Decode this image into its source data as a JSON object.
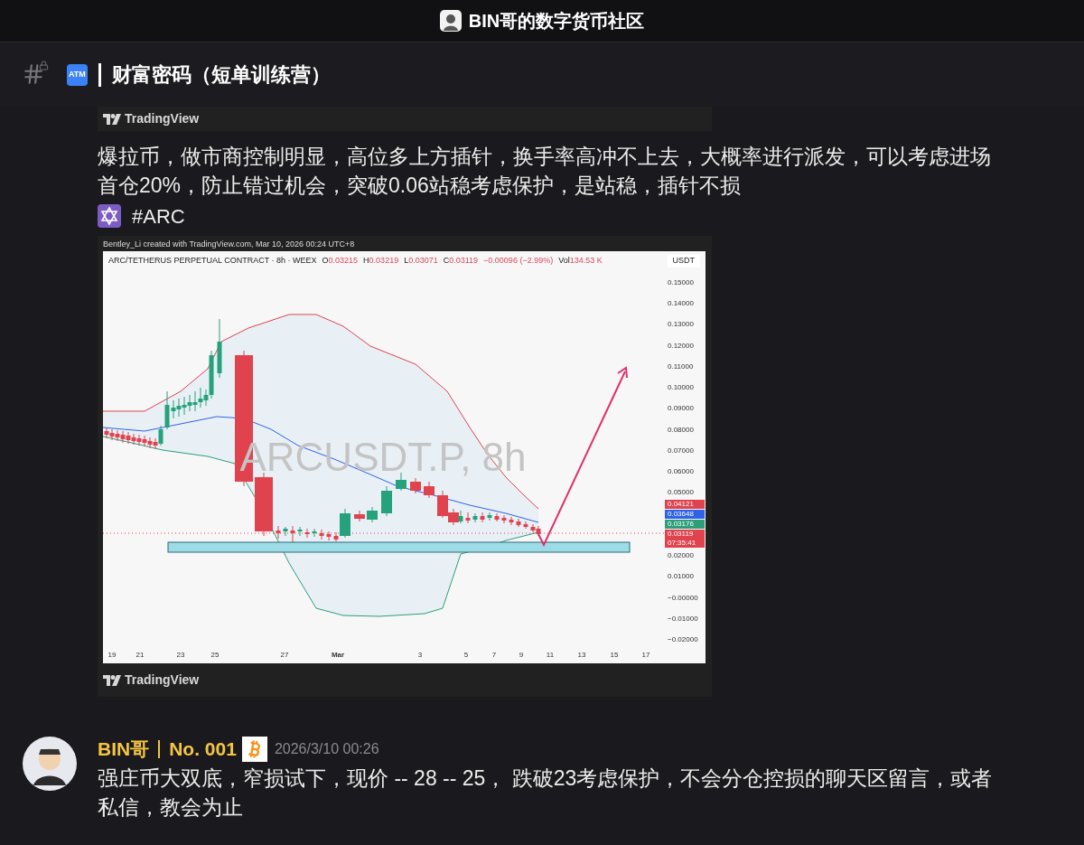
{
  "top_bar": {
    "title": "BIN哥的数字货币社区"
  },
  "channel": {
    "emoji_label": "ATM",
    "name": "财富密码（短单训练营）"
  },
  "embed_top": {
    "brand": "TradingView"
  },
  "message": {
    "text": "爆拉币，做市商控制明显，高位多上方插针，换手率高冲不上去，大概率进行派发，可以考虑进场首仓20%，防止错过机会，突破0.06站稳考虑保护，是站稳，插针不损",
    "tag": "#ARC"
  },
  "chart_image": {
    "created_by": "Bentley_Li created with TradingView.com, Mar 10, 2026 00:24 UTC+8",
    "symbol": "ARC/TETHERUS PERPETUAL CONTRACT · 8h · WEEX",
    "ohlc": [
      {
        "label": "O",
        "value": "0.03215"
      },
      {
        "label": "H",
        "value": "0.03219"
      },
      {
        "label": "L",
        "value": "0.03071"
      },
      {
        "label": "C",
        "value": "0.03119"
      }
    ],
    "change": "−0.00096 (−2.99%)",
    "volume": {
      "label": "Vol",
      "value": "134.53 K"
    },
    "currency": "USDT",
    "watermark": "ARCUSDT.P, 8h",
    "yticks": [
      "0.15000",
      "0.14000",
      "0.13000",
      "0.12000",
      "0.11000",
      "0.10000",
      "0.09000",
      "0.08000",
      "0.07000",
      "0.06000",
      "0.05000",
      "0.02000",
      "0.01000",
      "−0.00000",
      "−0.01000",
      "−0.02000"
    ],
    "price_labels": [
      {
        "lines": [
          "0.04121"
        ],
        "color": "#e0434e"
      },
      {
        "lines": [
          "0.03648"
        ],
        "color": "#2f62e8"
      },
      {
        "lines": [
          "0.03176"
        ],
        "color": "#2e9e78"
      },
      {
        "lines": [
          "0.03119",
          "07:35:41"
        ],
        "color": "#e0434e"
      }
    ],
    "xticks": [
      {
        "label": "19",
        "bold": false
      },
      {
        "label": "21",
        "bold": false
      },
      {
        "label": "23",
        "bold": false
      },
      {
        "label": "25",
        "bold": false
      },
      {
        "label": "27",
        "bold": false
      },
      {
        "label": "Mar",
        "bold": true
      },
      {
        "label": "3",
        "bold": false
      },
      {
        "label": "5",
        "bold": false
      },
      {
        "label": "7",
        "bold": false
      },
      {
        "label": "9",
        "bold": false
      },
      {
        "label": "11",
        "bold": false
      },
      {
        "label": "13",
        "bold": false
      },
      {
        "label": "15",
        "bold": false
      },
      {
        "label": "17",
        "bold": false
      }
    ],
    "brand": "TradingView"
  },
  "reply": {
    "author": "BIN哥",
    "badge": "No. 001",
    "time": "2026/3/10 00:26",
    "text": "强庄币大双底，窄损试下，现价 -- 28 -- 25， 跌破23考虑保护，不会分仓控损的聊天区留言，或者私信，教会为止"
  }
}
